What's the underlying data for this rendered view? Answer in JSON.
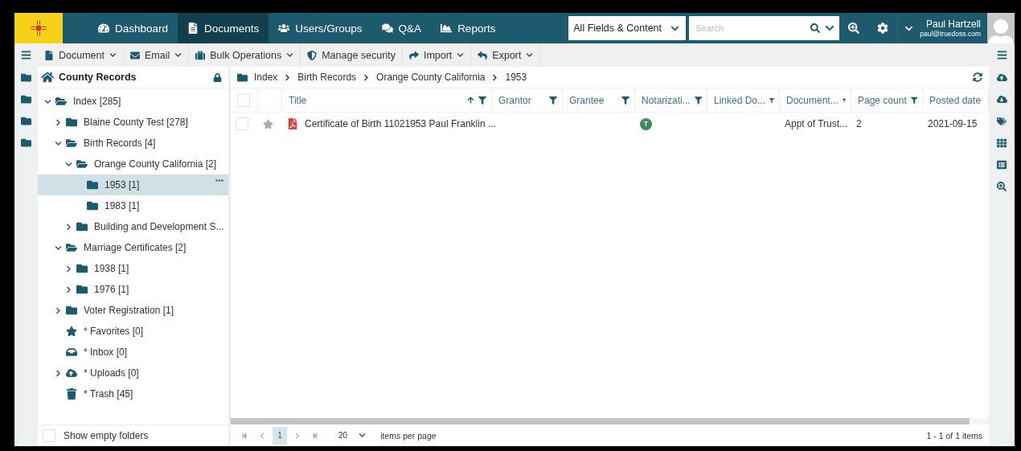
{
  "nav": {
    "items": [
      {
        "label": "Dashboard",
        "selected": false
      },
      {
        "label": "Documents",
        "selected": true
      },
      {
        "label": "Users/Groups",
        "selected": false
      },
      {
        "label": "Q&A",
        "selected": false
      },
      {
        "label": "Reports",
        "selected": false
      }
    ],
    "search_scope": "All Fields & Content",
    "search": {
      "placeholder": "Search"
    },
    "user": {
      "name": "Paul Hartzell",
      "email": "paul@truedoss.com"
    }
  },
  "toolbar": [
    {
      "label": "Document",
      "dropdown": true
    },
    {
      "label": "Email",
      "dropdown": true
    },
    {
      "label": "Bulk Operations",
      "dropdown": true
    },
    {
      "label": "Manage security",
      "dropdown": false
    },
    {
      "label": "Import",
      "dropdown": true
    },
    {
      "label": "Export",
      "dropdown": true
    }
  ],
  "tree_panel": {
    "title": "County Records",
    "tree": [
      {
        "label": "Index [285]",
        "kind": "folder",
        "expanded": true,
        "selected": false,
        "children": [
          {
            "label": "Blaine County Test [278]",
            "kind": "folder",
            "expanded": false,
            "selected": false
          },
          {
            "label": "Birth Records [4]",
            "kind": "folder",
            "expanded": true,
            "selected": false,
            "children": [
              {
                "label": "Orange County California [2]",
                "kind": "folder",
                "expanded": true,
                "selected": false,
                "children": [
                  {
                    "label": "1953 [1]",
                    "kind": "folder",
                    "selected": true
                  },
                  {
                    "label": "1983 [1]",
                    "kind": "folder",
                    "selected": false
                  }
                ]
              },
              {
                "label": "Building and Development S...",
                "kind": "folder",
                "expanded": false,
                "selected": false
              }
            ]
          },
          {
            "label": "Marriage Certificates [2]",
            "kind": "folder",
            "expanded": true,
            "selected": false,
            "children": [
              {
                "label": "1938 [1]",
                "kind": "folder",
                "expanded": false,
                "selected": false
              },
              {
                "label": "1976 [1]",
                "kind": "folder",
                "expanded": false,
                "selected": false
              }
            ]
          },
          {
            "label": "Voter Registration [1]",
            "kind": "folder",
            "expanded": false,
            "selected": false
          }
        ]
      }
    ],
    "pinned": [
      {
        "label": "* Favorites [0]",
        "kind": "star",
        "selected": false
      },
      {
        "label": "* Inbox [0]",
        "kind": "inbox",
        "selected": false
      },
      {
        "label": "* Uploads [0]",
        "kind": "cloud",
        "expanded": false,
        "selected": false
      },
      {
        "label": "* Trash [45]",
        "kind": "trash",
        "selected": false
      }
    ],
    "show_empty": {
      "label": "Show empty folders",
      "checked": false
    }
  },
  "breadcrumb": [
    "Index",
    "Birth Records",
    "Orange County California",
    "1953"
  ],
  "table": {
    "select_all_checked": false,
    "columns": [
      {
        "label": "Title",
        "sorted": true
      },
      {
        "label": "Grantor",
        "sorted": false
      },
      {
        "label": "Grantee",
        "sorted": false
      },
      {
        "label": "Notarizati...",
        "sorted": false
      },
      {
        "label": "Linked Do...",
        "sorted": false
      },
      {
        "label": "Document...",
        "sorted": false
      },
      {
        "label": "Page count",
        "sorted": false
      },
      {
        "label": "Posted date",
        "sorted": false
      }
    ],
    "rows": [
      {
        "checked": false,
        "starred": false,
        "title": "Certificate of Birth 11021953 Paul Franklin ...",
        "notarization": "T",
        "document_type": "Appt of Trust...",
        "page_count": "2",
        "posted_date": "2021-09-15"
      }
    ]
  },
  "pager": {
    "pages": [
      {
        "label": "1",
        "selected": true
      }
    ],
    "page_size": "20",
    "page_size_label": "items per page",
    "summary": "1 - 1 of 1 items"
  }
}
